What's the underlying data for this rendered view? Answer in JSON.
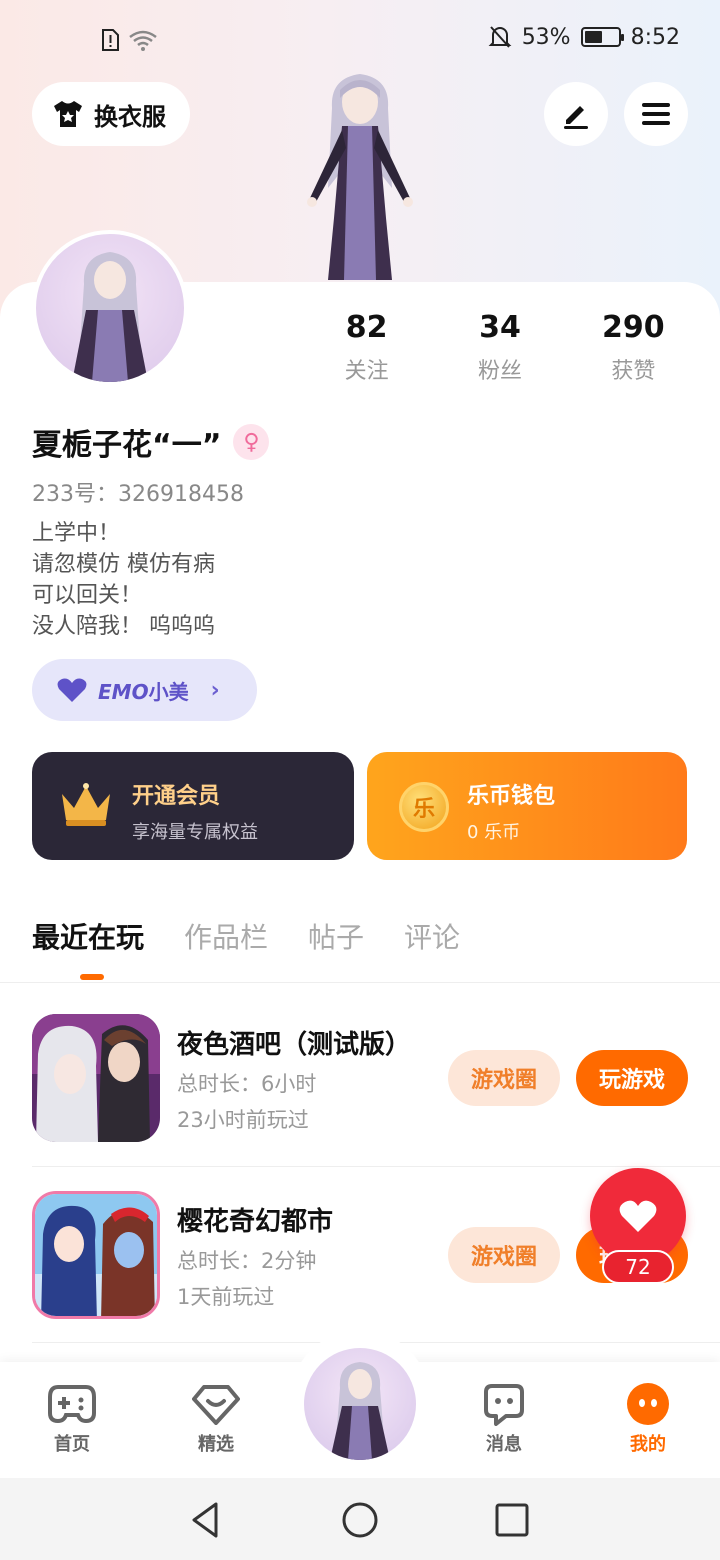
{
  "status_bar": {
    "battery_percent": "53%",
    "battery_level": 0.53,
    "time": "8:52"
  },
  "header": {
    "outfit_button": "换衣服",
    "edit_icon": "edit-icon",
    "menu_icon": "menu-icon"
  },
  "profile": {
    "stats": [
      {
        "value": "82",
        "label": "关注"
      },
      {
        "value": "34",
        "label": "粉丝"
      },
      {
        "value": "290",
        "label": "获赞"
      }
    ],
    "name": "夏栀子花“一”",
    "gender_symbol": "♀",
    "uid": "233号：326918458",
    "bio_lines": [
      "上学中！",
      "请忽模仿 模仿有病",
      "可以回关！",
      "没人陪我！ 呜呜呜"
    ],
    "emo_chip": {
      "brand": "EMO",
      "label": "小美",
      "chevron": "›"
    }
  },
  "cards": {
    "vip": {
      "title": "开通会员",
      "subtitle": "享海量专属权益"
    },
    "wallet": {
      "title": "乐币钱包",
      "subtitle": "0 乐币",
      "coin_glyph": "乐"
    }
  },
  "tabs": [
    "最近在玩",
    "作品栏",
    "帖子",
    "评论"
  ],
  "active_tab": 0,
  "games": [
    {
      "title": "夜色酒吧（测试版）",
      "duration": "总时长：6小时",
      "last_played": "23小时前玩过",
      "circle_button": "游戏圈",
      "play_button": "玩游戏"
    },
    {
      "title": "樱花奇幻都市",
      "duration": "总时长：2分钟",
      "last_played": "1天前玩过",
      "circle_button": "游戏圈",
      "play_button": "玩游戏"
    }
  ],
  "like_float": {
    "count": "72"
  },
  "bottom_nav": [
    {
      "label": "首页",
      "icon": "gamepad-icon"
    },
    {
      "label": "精选",
      "icon": "heart-diamond-icon"
    },
    {
      "label": "消息",
      "icon": "chat-icon"
    },
    {
      "label": "我的",
      "icon": "profile-face-icon"
    }
  ],
  "colors": {
    "accent": "#ff6a00",
    "vip_dark": "#2b2737",
    "like_red": "#f02a3a",
    "emo_purple": "#5e52c8"
  }
}
